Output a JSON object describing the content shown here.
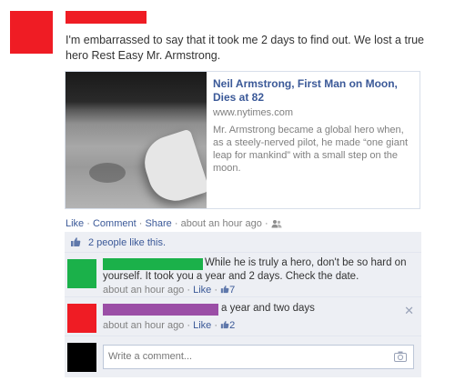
{
  "post": {
    "text": "I'm embarrassed to say that it took me 2 days to find out. We lost a true hero Rest Easy Mr. Armstrong.",
    "redaction_color": "#ef1c24"
  },
  "shared_link": {
    "title": "Neil Armstrong, First Man on Moon, Dies at 82",
    "domain": "www.nytimes.com",
    "description": "Mr. Armstrong became a global hero when, as a steely-nerved pilot, he made “one giant leap for mankind” with a small step on the moon."
  },
  "actions": {
    "like": "Like",
    "comment": "Comment",
    "share": "Share",
    "time": "about an hour ago",
    "sep": " · "
  },
  "likes": {
    "text": "2 people like this."
  },
  "comments": [
    {
      "name_color": "#1bb14a",
      "text": "While he is truly a hero, don't be so hard on yourself. It took you a year and 2 days. Check the date.",
      "time": "about an hour ago",
      "like": "Like",
      "count": "7",
      "avatar_color": "#1bb14a"
    },
    {
      "name_color": "#9b4ea6",
      "text": "a year and two days",
      "time": "about an hour ago",
      "like": "Like",
      "count": "2",
      "avatar_color": "#ef1c24"
    }
  ],
  "composer": {
    "placeholder": "Write a comment..."
  },
  "colors": {
    "link": "#3b5998",
    "ufi_background": "#edeff4"
  }
}
